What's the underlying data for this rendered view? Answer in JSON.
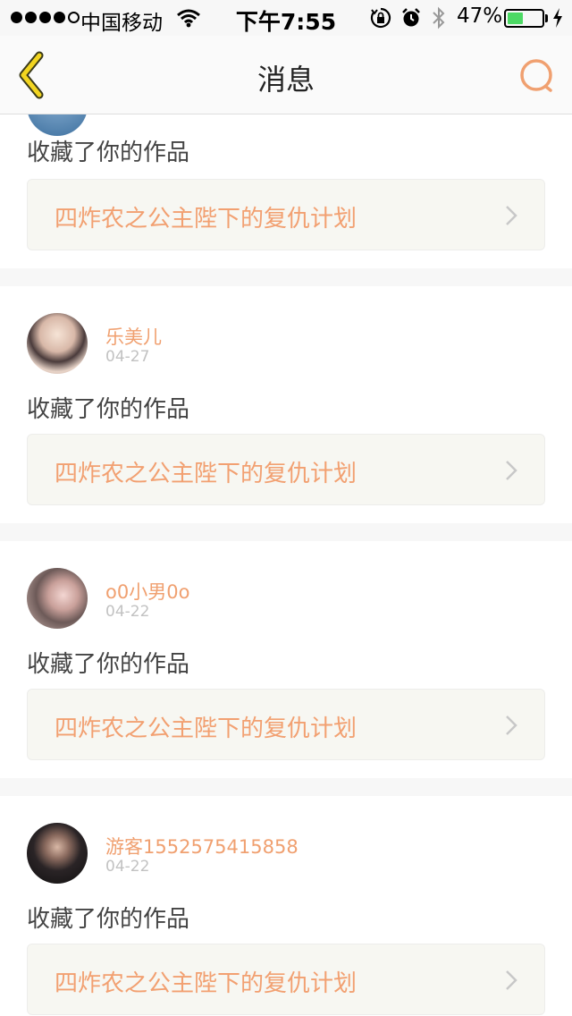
{
  "status_bar": {
    "carrier": "中国移动",
    "time": "下午7:55",
    "battery_percent": "47%",
    "battery_level": 0.47,
    "signal_bars_filled": 4,
    "signal_bars_total": 5
  },
  "nav": {
    "title": "消息",
    "accent_color": "#f0a070",
    "back_icon": "chevron-left-icon",
    "search_icon": "search-icon"
  },
  "messages": [
    {
      "action": "收藏了你的作品",
      "work_title": "四炸农之公主陛下的复仇计划"
    },
    {
      "username": "乐美儿",
      "date": "04-27",
      "action": "收藏了你的作品",
      "work_title": "四炸农之公主陛下的复仇计划"
    },
    {
      "username": "o0小男0o",
      "date": "04-22",
      "action": "收藏了你的作品",
      "work_title": "四炸农之公主陛下的复仇计划"
    },
    {
      "username": "游客1552575415858",
      "date": "04-22",
      "action": "收藏了你的作品",
      "work_title": "四炸农之公主陛下的复仇计划"
    }
  ]
}
